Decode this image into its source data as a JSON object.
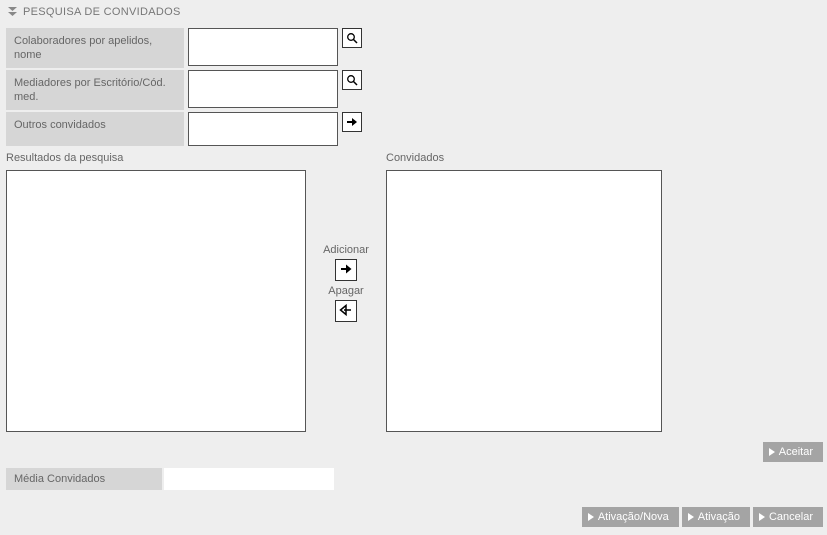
{
  "section_title": "PESQUISA DE CONVIDADOS",
  "fields": {
    "collaborators_label": "Colaboradores por apelidos, nome",
    "mediators_label": "Mediadores por Escritório/Cód. med.",
    "others_label": "Outros convidados"
  },
  "lists": {
    "results_label": "Resultados da pesquisa",
    "guests_label": "Convidados"
  },
  "transfer": {
    "add_label": "Adicionar",
    "remove_label": "Apagar"
  },
  "buttons": {
    "accept": "Aceitar",
    "activation_new": "Ativação/Nova",
    "activation": "Ativação",
    "cancel": "Cancelar"
  },
  "bottom": {
    "avg_label": "Média Convidados",
    "avg_value": ""
  }
}
